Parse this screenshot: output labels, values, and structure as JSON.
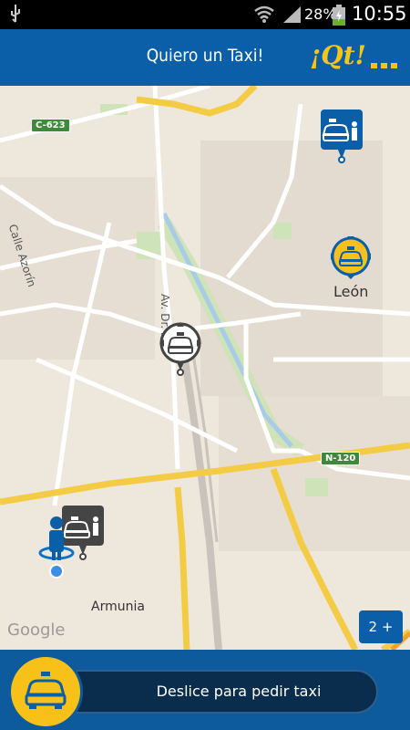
{
  "status_bar": {
    "battery": "28%",
    "time": "10:55"
  },
  "app_bar": {
    "title": "Quiero un Taxi!",
    "brand": "¡Qt!"
  },
  "map": {
    "road_labels": {
      "c623": "C-623",
      "n120": "N-120",
      "calle_azorin": "Calle Azorín",
      "av": "Av. Dr. Fl"
    },
    "cities": {
      "leon": "León",
      "armunia": "Armunia"
    },
    "attribution": "Google",
    "taxi_count_badge": "2 +"
  },
  "slider": {
    "label": "Deslice para pedir taxi"
  },
  "colors": {
    "app_blue": "#0b5ea8",
    "accent_yellow": "#f7c11a",
    "map_bg": "#ede7dc"
  }
}
